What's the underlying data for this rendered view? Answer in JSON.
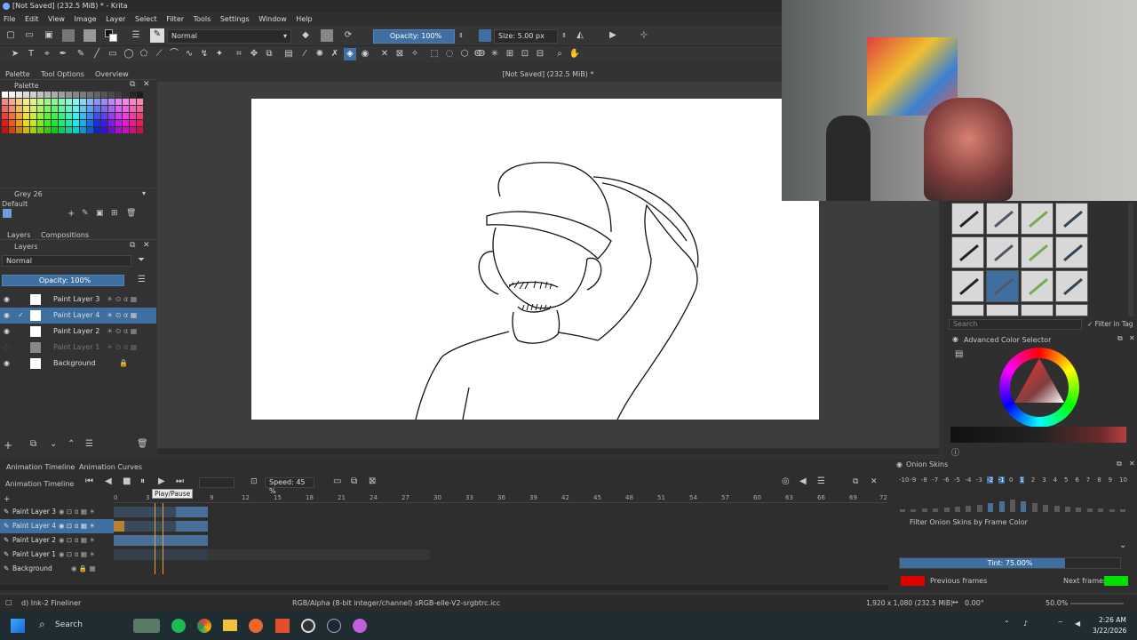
{
  "window": {
    "title": "[Not Saved]  (232.5 MiB) * - Krita"
  },
  "menu": [
    "File",
    "Edit",
    "View",
    "Image",
    "Layer",
    "Select",
    "Filter",
    "Tools",
    "Settings",
    "Window",
    "Help"
  ],
  "toolbar": {
    "blend_mode": "Normal",
    "opacity": "Opacity: 100%",
    "size": "Size: 5.00 px"
  },
  "document_tab": "[Not Saved]  (232.5 MiB) *",
  "dockers_top": {
    "tabs": [
      "Palette",
      "Tool Options",
      "Overview"
    ],
    "palette_title": "Palette",
    "color_name": "Grey 26",
    "palette_set": "Default"
  },
  "layers_panel": {
    "tabs": [
      "Layers",
      "Compositions"
    ],
    "title": "Layers",
    "blend_mode": "Normal",
    "opacity": "Opacity:  100%",
    "layers": [
      {
        "name": "Paint Layer 3",
        "selected": false,
        "dim": false
      },
      {
        "name": "Paint Layer 4",
        "selected": true,
        "dim": false
      },
      {
        "name": "Paint Layer 2",
        "selected": false,
        "dim": false
      },
      {
        "name": "Paint Layer 1",
        "selected": false,
        "dim": true
      },
      {
        "name": "Background",
        "selected": false,
        "dim": false
      }
    ]
  },
  "timeline": {
    "tabs": [
      "Animation Timeline",
      "Animation Curves"
    ],
    "title": "Animation Timeline",
    "speed": "Speed: 45 %",
    "tooltip": "Play/Pause",
    "ruler": [
      "0",
      "3",
      "9",
      "12",
      "15",
      "18",
      "21",
      "24",
      "27",
      "30",
      "33",
      "36",
      "39",
      "42",
      "45",
      "48",
      "51",
      "54",
      "57",
      "60",
      "63",
      "66",
      "69",
      "72"
    ],
    "layers": [
      "Paint Layer 3",
      "Paint Layer 4",
      "Paint Layer 2",
      "Paint Layer 1",
      "Background"
    ]
  },
  "onion": {
    "title": "Onion Skins",
    "numbers": [
      "-10",
      "-9",
      "-8",
      "-7",
      "-6",
      "-5",
      "-4",
      "-3",
      "-2",
      "-1",
      "0",
      "1",
      "2",
      "3",
      "4",
      "5",
      "6",
      "7",
      "8",
      "9",
      "10"
    ],
    "filter_label": "Filter Onion Skins by Frame Color",
    "tint": "Tint: 75.00%",
    "previous": "Previous frames",
    "next": "Next frames",
    "prev_color": "#e00000",
    "next_color": "#00e000"
  },
  "right_panel": {
    "search_placeholder": "Search",
    "filter_in_tag": "Filter in Tag",
    "color_selector_title": "Advanced Color Selector"
  },
  "status": {
    "brush": "d) Ink-2 Fineliner",
    "color_space": "RGB/Alpha (8-bit integer/channel)  sRGB-elle-V2-srgbtrc.icc",
    "dimensions": "1,920 x 1,080 (232.5 MiB)",
    "rotation": "0.00°",
    "zoom": "50.0%"
  },
  "taskbar": {
    "search": "Search",
    "time": "2:26 AM",
    "date": "3/22/2026"
  }
}
